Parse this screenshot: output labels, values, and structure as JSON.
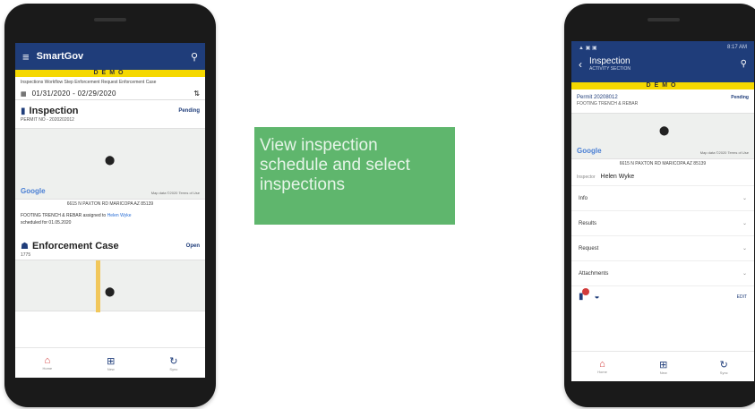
{
  "left_phone": {
    "app_title": "SmartGov",
    "demo_label": "DEMO",
    "breadcrumbs": "Inspections   Workflow Step   Enforcement Request   Enforcement Case",
    "date_range": "01/31/2020 - 02/29/2020",
    "inspection": {
      "title": "Inspection",
      "status": "Pending",
      "permit": "PERMIT NO - 2020202012",
      "map_google": "Google",
      "map_data": "Map data ©2020    Terms of Use",
      "address": "6615 N PAXTON RD MARICOPA AZ 85139",
      "description_main": "FOOTING TRENCH & REBAR",
      "description_assigned": "assigned to",
      "description_user": "Helen Wyke",
      "description_scheduled": "scheduled for 01.05.2020"
    },
    "enforcement": {
      "title": "Enforcement Case",
      "status": "Open",
      "number": "1775"
    },
    "nav": {
      "home": "Home",
      "new": "New",
      "sync": "Sync"
    }
  },
  "callout": {
    "text": "View inspection schedule and select inspections"
  },
  "right_phone": {
    "status_left": "▲ ▣ ▣",
    "status_right": "8:17 AM",
    "title": "Inspection",
    "subtitle": "ACTIVITY SECTION",
    "demo_label": "DEMO",
    "permit_number": "Permit 20208012",
    "permit_status": "Pending",
    "permit_sub": "FOOTING TRENCH & REBAR",
    "map_google": "Google",
    "map_data": "Map data ©2020    Terms of Use",
    "address": "6615 N PAXTON RD MARICOPA AZ 85139",
    "inspector_label": "Inspector",
    "inspector_name": "Helen Wyke",
    "rows": [
      "Info",
      "Results",
      "Request",
      "Attachments"
    ],
    "edit_label": "EDIT",
    "nav": {
      "home": "Home",
      "new": "New",
      "sync": "Sync"
    }
  }
}
